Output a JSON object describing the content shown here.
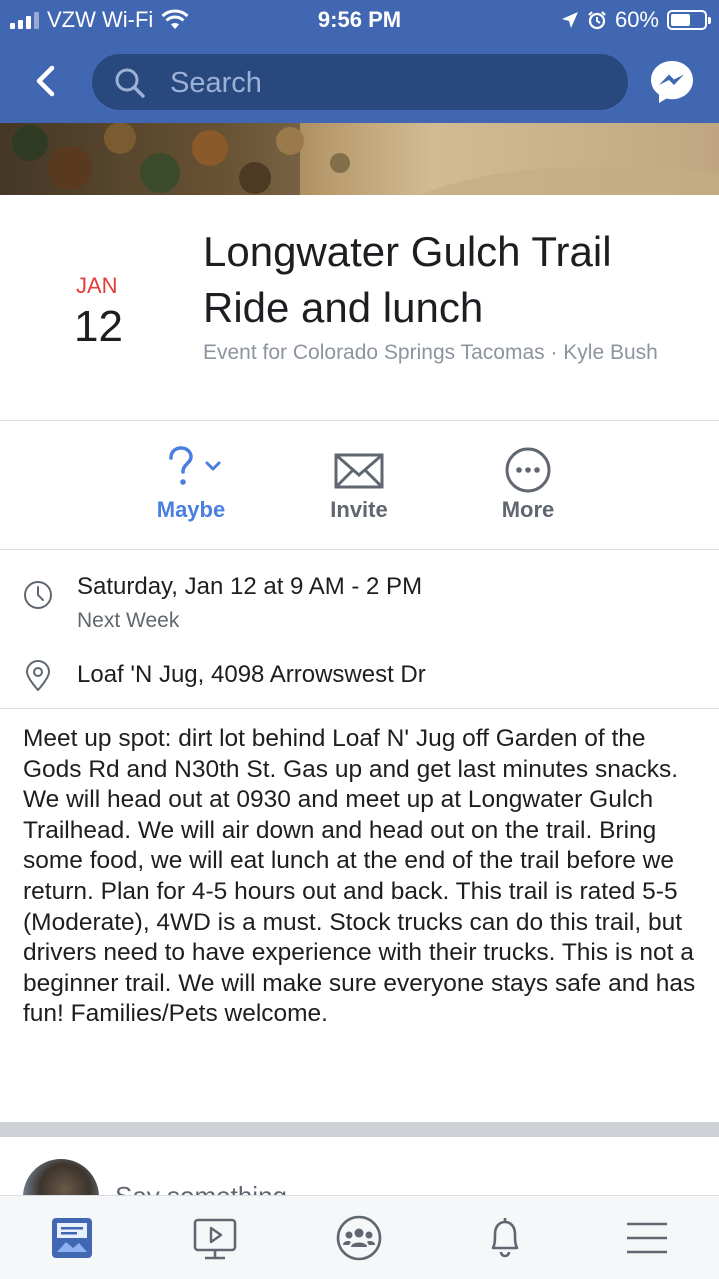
{
  "status_bar": {
    "carrier": "VZW Wi-Fi",
    "time": "9:56 PM",
    "battery": "60%",
    "battery_level": 0.6
  },
  "nav": {
    "search_placeholder": "Search",
    "back_icon": "chevron-left-icon",
    "messenger_icon": "messenger-icon"
  },
  "event": {
    "month": "JAN",
    "day": "12",
    "title": "Longwater Gulch Trail Ride and lunch",
    "subtitle": "Event for Colorado Springs Tacomas · Kyle Bush"
  },
  "actions": [
    {
      "label": "Maybe",
      "icon": "question-icon"
    },
    {
      "label": "Invite",
      "icon": "envelope-icon"
    },
    {
      "label": "More",
      "icon": "more-icon"
    }
  ],
  "details": {
    "datetime": "Saturday, Jan 12 at 9 AM - 2 PM",
    "relative": "Next Week",
    "location": "Loaf 'N Jug, 4098 Arrowswest Dr"
  },
  "description": "Meet up spot: dirt lot behind Loaf N' Jug off Garden of the Gods Rd and N30th St. Gas up and get last minutes snacks. We will head out at 0930 and meet up at Longwater Gulch Trailhead. We will air down and head out on the trail. Bring some food, we will eat lunch at the end of the trail before we return. Plan for 4-5 hours out and back. This trail is rated 5-5 (Moderate), 4WD is a must. Stock trucks can do this trail, but drivers need to have experience with their trucks. This is not a beginner trail. We will make sure everyone stays safe and has fun! Families/Pets welcome.",
  "composer": {
    "placeholder": "Say something..."
  },
  "tabbar": [
    {
      "icon": "news-feed-icon",
      "active": true
    },
    {
      "icon": "watch-icon",
      "active": false
    },
    {
      "icon": "groups-icon",
      "active": false
    },
    {
      "icon": "notifications-icon",
      "active": false
    },
    {
      "icon": "menu-icon",
      "active": false
    }
  ],
  "colors": {
    "brand": "#4267b2",
    "accent": "#4a7ee0",
    "date_red": "#e0403a"
  }
}
